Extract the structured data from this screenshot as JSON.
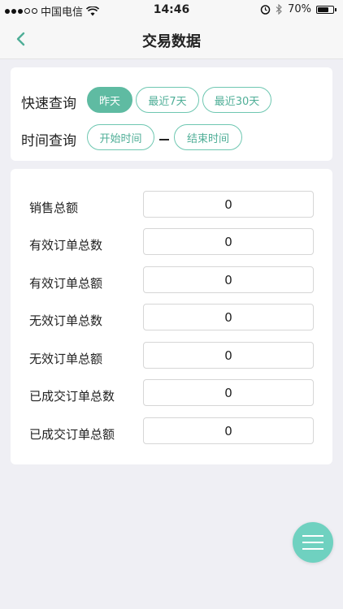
{
  "status_bar": {
    "carrier": "中国电信",
    "time": "14:46",
    "battery": "70%",
    "battery_level": 0.7,
    "icons": [
      "signal-dots",
      "wifi-icon",
      "alarm-icon",
      "bluetooth-icon",
      "battery-icon"
    ]
  },
  "nav": {
    "title": "交易数据",
    "back_icon": "chevron-left-icon"
  },
  "quick_query": {
    "label": "快速查询",
    "options": [
      {
        "label": "昨天",
        "active": true
      },
      {
        "label": "最近7天",
        "active": false
      },
      {
        "label": "最近30天",
        "active": false
      }
    ]
  },
  "time_query": {
    "label": "时间查询",
    "start_label": "开始时间",
    "separator": "—",
    "end_label": "结束时间"
  },
  "stats": [
    {
      "label": "销售总额",
      "value": "0"
    },
    {
      "label": "有效订单总数",
      "value": "0"
    },
    {
      "label": "有效订单总额",
      "value": "0"
    },
    {
      "label": "无效订单总数",
      "value": "0"
    },
    {
      "label": "无效订单总额",
      "value": "0"
    },
    {
      "label": "已成交订单总数",
      "value": "0"
    },
    {
      "label": "已成交订单总额",
      "value": "0"
    }
  ],
  "fab": {
    "icon": "menu-icon"
  },
  "colors": {
    "accent": "#5fbba2",
    "accent_border": "#6ec7b1",
    "fab": "#6fd1c0",
    "background": "#efeff4"
  }
}
